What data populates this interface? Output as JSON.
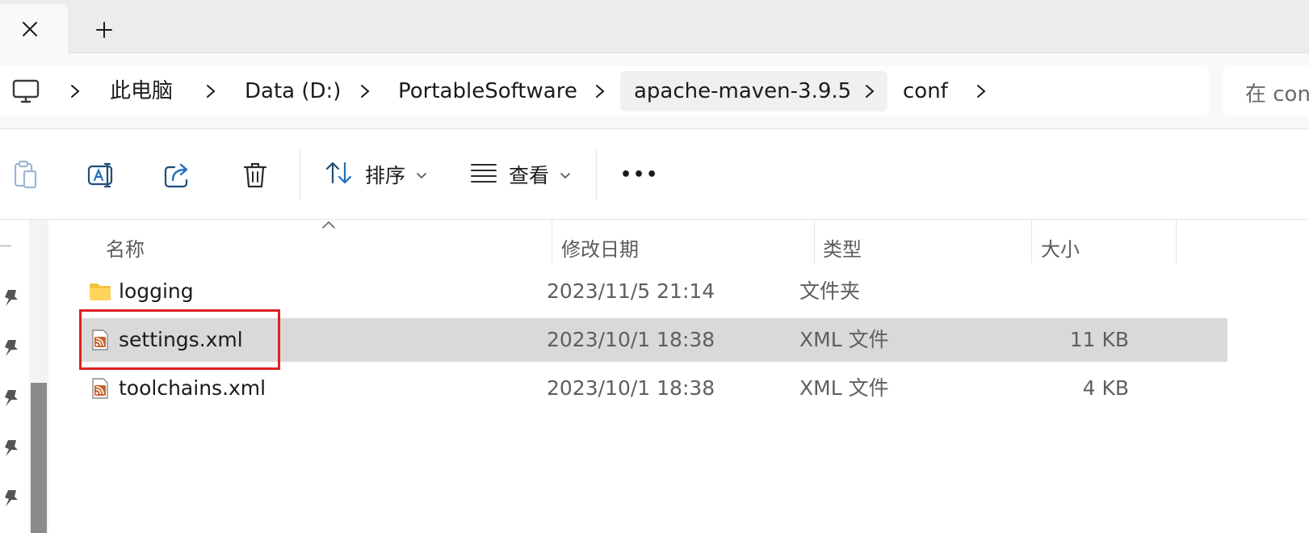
{
  "tabs": {
    "close_icon": "close-icon",
    "new_tab_icon": "plus-icon"
  },
  "address_bar": {
    "breadcrumbs": [
      "此电脑",
      "Data (D:)",
      "PortableSoftware",
      "apache-maven-3.9.5",
      "conf"
    ],
    "search_placeholder": "在 conf"
  },
  "command_bar": {
    "sort_label": "排序",
    "view_label": "查看",
    "more_label": "•••"
  },
  "columns": {
    "name": "名称",
    "modified": "修改日期",
    "type": "类型",
    "size": "大小"
  },
  "files": [
    {
      "name": "logging",
      "modified": "2023/11/5 21:14",
      "type": "文件夹",
      "size": "",
      "icon": "folder-icon",
      "selected": false
    },
    {
      "name": "settings.xml",
      "modified": "2023/10/1 18:38",
      "type": "XML 文件",
      "size": "11 KB",
      "icon": "xml-file-icon",
      "selected": true
    },
    {
      "name": "toolchains.xml",
      "modified": "2023/10/1 18:38",
      "type": "XML 文件",
      "size": "4 KB",
      "icon": "xml-file-icon",
      "selected": false
    }
  ],
  "colors": {
    "accent": "#0067c0",
    "selection": "#d9d9d9",
    "annotation": "#e02020",
    "folder": "#f4c23e",
    "xml": "#c8622a"
  }
}
